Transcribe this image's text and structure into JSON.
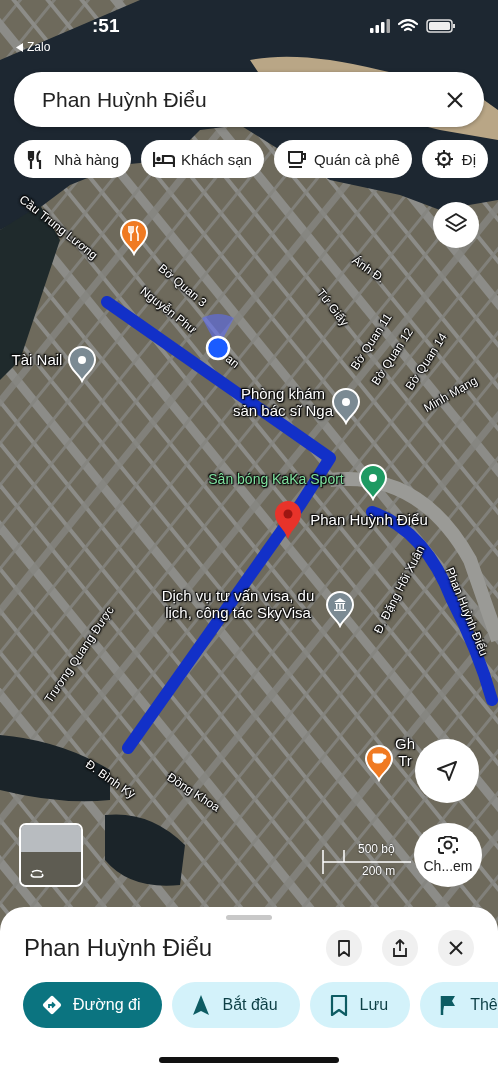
{
  "status_bar": {
    "time": ":51",
    "back_app": "Zalo"
  },
  "search": {
    "value": "Phan Huỳnh Điểu"
  },
  "categories": [
    {
      "label": "Nhà hàng"
    },
    {
      "label": "Khách sạn"
    },
    {
      "label": "Quán cà phê"
    },
    {
      "label": "Đị"
    }
  ],
  "map": {
    "labels": [
      {
        "text": "Cầu Trung Lương",
        "kind": "street"
      },
      {
        "text": "Bờ Quan 3",
        "kind": "street"
      },
      {
        "text": "Nguyễn Phư",
        "kind": "street"
      },
      {
        "text": "an",
        "kind": "street"
      },
      {
        "text": "Ánh Đ.",
        "kind": "street"
      },
      {
        "text": "Tứ Giấy",
        "kind": "street"
      },
      {
        "text": "Bờ Quan 11",
        "kind": "street"
      },
      {
        "text": "Bờ Quan 12",
        "kind": "street"
      },
      {
        "text": "Bờ Quan 14",
        "kind": "street"
      },
      {
        "text": "Minh Mạng",
        "kind": "street"
      },
      {
        "text": "Tài Nail",
        "kind": "place"
      },
      {
        "text": "Phòng khám\nsản bác sĩ Nga",
        "kind": "place"
      },
      {
        "text": "Sân bóng KaKa Sport",
        "kind": "place_green"
      },
      {
        "text": "Phan Huỳnh Điểu",
        "kind": "place"
      },
      {
        "text": "Dịch vụ tư vấn visa, du\nlịch, công tác SkyVisa",
        "kind": "place"
      },
      {
        "text": "Đ. Đặng Hồi Xuân",
        "kind": "street"
      },
      {
        "text": "Phan Huỳnh Điểu",
        "kind": "street"
      },
      {
        "text": "Trương Quang Được",
        "kind": "street"
      },
      {
        "text": "Đ. Bình Kỳ",
        "kind": "street"
      },
      {
        "text": "Đồng Khoa",
        "kind": "street"
      },
      {
        "text": "Gh\nTr",
        "kind": "place"
      }
    ],
    "pins": [
      {
        "kind": "restaurant"
      },
      {
        "kind": "place"
      },
      {
        "kind": "place"
      },
      {
        "kind": "sport"
      },
      {
        "kind": "selected"
      },
      {
        "kind": "government"
      },
      {
        "kind": "cafe"
      }
    ],
    "lens_label": "Ch...em",
    "scale": {
      "imperial": "500 bộ",
      "metric": "200 m"
    }
  },
  "sheet": {
    "title": "Phan Huỳnh Điểu",
    "chips": [
      {
        "label": "Đường đi",
        "selected": true
      },
      {
        "label": "Bắt đầu",
        "selected": false
      },
      {
        "label": "Lưu",
        "selected": false
      },
      {
        "label": "Thê",
        "selected": false
      }
    ]
  }
}
